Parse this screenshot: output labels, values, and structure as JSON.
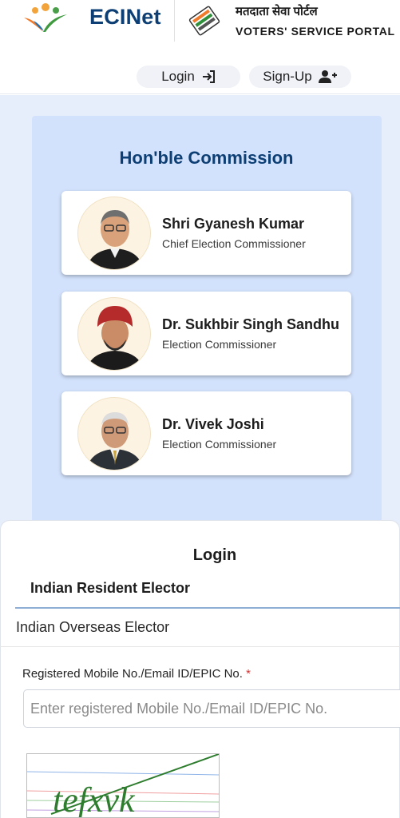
{
  "header": {
    "brand": "ECINet",
    "portal_hindi": "मतदाता सेवा पोर्टल",
    "portal_english": "VOTERS' SERVICE PORTAL",
    "login_label": "Login",
    "signup_label": "Sign-Up"
  },
  "commission": {
    "title": "Hon'ble Commission",
    "members": [
      {
        "name": "Shri Gyanesh Kumar",
        "role": "Chief Election Commissioner"
      },
      {
        "name": "Dr. Sukhbir Singh Sandhu",
        "role": "Election Commissioner"
      },
      {
        "name": "Dr. Vivek Joshi",
        "role": "Election Commissioner"
      }
    ]
  },
  "login": {
    "title": "Login",
    "tabs": [
      "Indian Resident Elector",
      "Indian Overseas Elector"
    ],
    "active_tab": "Indian Resident Elector",
    "field_label": "Registered Mobile No./Email ID/EPIC No.",
    "required_mark": "*",
    "placeholder": "Enter registered Mobile No./Email ID/EPIC No.",
    "value": "",
    "captcha_text": "tefxvk"
  },
  "colors": {
    "brand": "#0d3f74",
    "panel": "#d3e2fc",
    "section_bg": "#e6eefb",
    "required": "#d32f2f"
  },
  "icons": [
    "eci-logo",
    "voters-portal-logo",
    "login-icon",
    "add-user-icon"
  ]
}
